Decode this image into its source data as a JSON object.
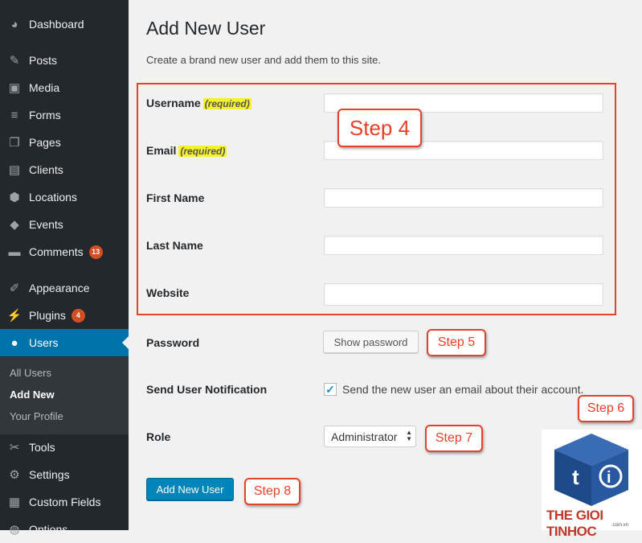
{
  "sidebar": {
    "items": [
      {
        "label": "Dashboard",
        "icon": "dashboard-icon",
        "glyph": "◕"
      },
      {
        "label": "Posts",
        "icon": "pin-icon",
        "glyph": "✎"
      },
      {
        "label": "Media",
        "icon": "media-icon",
        "glyph": "▣"
      },
      {
        "label": "Forms",
        "icon": "forms-icon",
        "glyph": "≡"
      },
      {
        "label": "Pages",
        "icon": "pages-icon",
        "glyph": "❐"
      },
      {
        "label": "Clients",
        "icon": "clients-icon",
        "glyph": "▤"
      },
      {
        "label": "Locations",
        "icon": "location-icon",
        "glyph": "⬢"
      },
      {
        "label": "Events",
        "icon": "events-icon",
        "glyph": "◆"
      },
      {
        "label": "Comments",
        "icon": "comment-icon",
        "glyph": "▬",
        "badge": "13"
      },
      {
        "label": "Appearance",
        "icon": "brush-icon",
        "glyph": "✐"
      },
      {
        "label": "Plugins",
        "icon": "plugin-icon",
        "glyph": "⚡",
        "badge": "4"
      },
      {
        "label": "Users",
        "icon": "user-icon",
        "glyph": "●",
        "active": true
      },
      {
        "label": "Tools",
        "icon": "wrench-icon",
        "glyph": "✂"
      },
      {
        "label": "Settings",
        "icon": "settings-icon",
        "glyph": "⚙"
      },
      {
        "label": "Custom Fields",
        "icon": "table-icon",
        "glyph": "▦"
      },
      {
        "label": "Options",
        "icon": "options-icon",
        "glyph": "◍"
      }
    ],
    "submenu": [
      "All Users",
      "Add New",
      "Your Profile"
    ]
  },
  "page": {
    "title": "Add New User",
    "description": "Create a brand new user and add them to this site."
  },
  "form": {
    "username_label": "Username",
    "email_label": "Email",
    "required_text": "(required)",
    "first_name_label": "First Name",
    "last_name_label": "Last Name",
    "website_label": "Website",
    "password_label": "Password",
    "show_password_label": "Show password",
    "notification_label": "Send User Notification",
    "notification_text": "Send the new user an email about their account.",
    "notification_checked": true,
    "role_label": "Role",
    "role_value": "Administrator",
    "submit_label": "Add New User"
  },
  "annotations": {
    "step4": "Step 4",
    "step5": "Step 5",
    "step6": "Step 6",
    "step7": "Step 7",
    "step8": "Step 8",
    "highlight_color": "#e8412a"
  },
  "watermark": {
    "text": "THE GIOI TINHOC",
    "subtext": ".com.vn"
  }
}
